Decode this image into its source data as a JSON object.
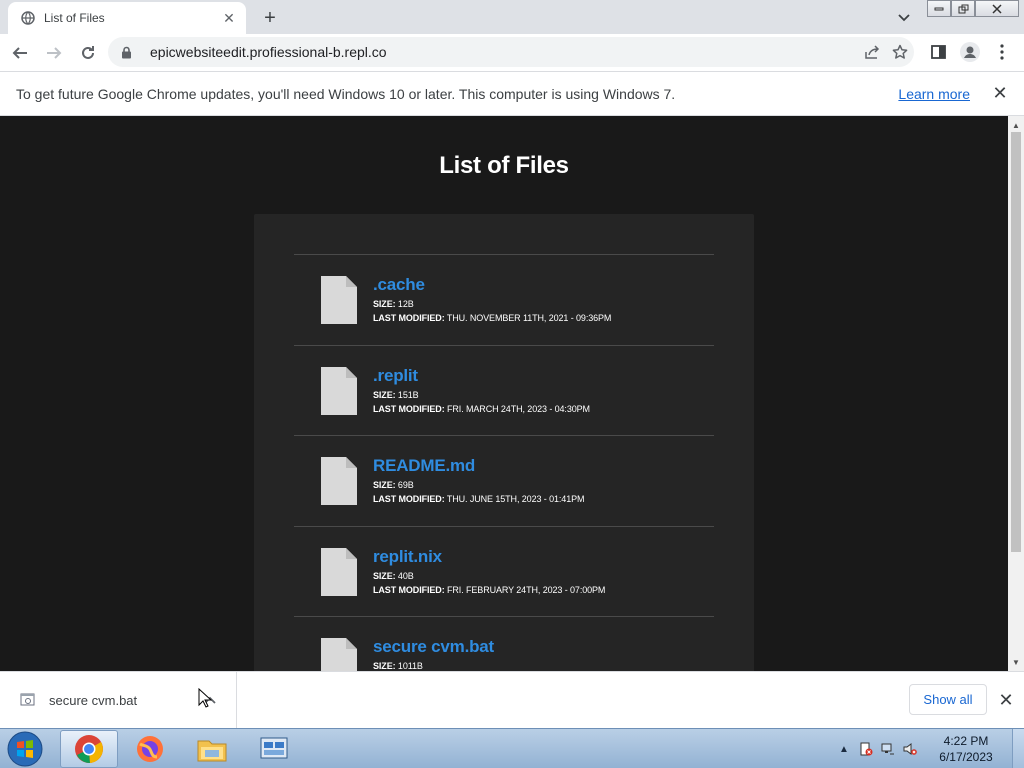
{
  "browser": {
    "tab": {
      "title": "List of Files"
    },
    "url": "epicwebsiteedit.profiessional-b.repl.co"
  },
  "infobar": {
    "message": "To get future Google Chrome updates, you'll need Windows 10 or later. This computer is using Windows 7.",
    "link": "Learn more"
  },
  "page": {
    "title": "List of Files",
    "size_label": "SIZE:",
    "modified_label": "LAST MODIFIED:",
    "files": [
      {
        "name": ".cache",
        "size": "12B",
        "modified": "THU. NOVEMBER 11TH, 2021 - 09:36PM"
      },
      {
        "name": ".replit",
        "size": "151B",
        "modified": "FRI. MARCH 24TH, 2023 - 04:30PM"
      },
      {
        "name": "README.md",
        "size": "69B",
        "modified": "THU. JUNE 15TH, 2023 - 01:41PM"
      },
      {
        "name": "replit.nix",
        "size": "40B",
        "modified": "FRI. FEBRUARY 24TH, 2023 - 07:00PM"
      },
      {
        "name": "secure cvm.bat",
        "size": "1011B",
        "modified": ""
      }
    ]
  },
  "downloads": {
    "item": "secure cvm.bat",
    "show_all": "Show all"
  },
  "taskbar": {
    "time": "4:22 PM",
    "date": "6/17/2023"
  },
  "colors": {
    "page_bg": "#191919",
    "panel_bg": "#252525",
    "link": "#2f8ce0"
  }
}
